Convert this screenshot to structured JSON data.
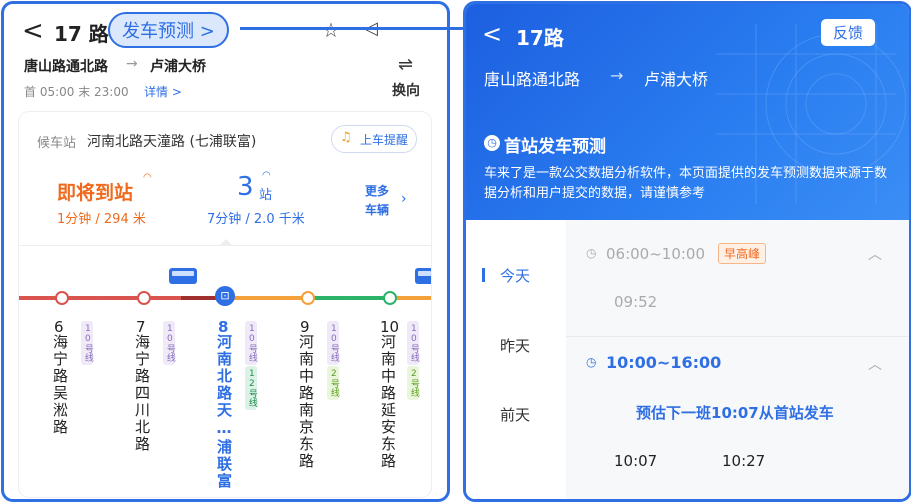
{
  "left": {
    "back_glyph": "<",
    "route": "17 路",
    "predict_pill": "发车预测 >",
    "from": "唐山路通北路",
    "to": "卢浦大桥",
    "arrow": "→",
    "hours": "首 05:00 末 23:00",
    "detail": "详情 >",
    "switch_label": "换向",
    "card": {
      "wait_label": "候车站",
      "wait_station": "河南北路天潼路 (七浦联富)",
      "remind_btn": "上车提醒",
      "bus1_status": "即将到站",
      "bus1_detail": "1分钟 / 294 米",
      "bus2_stops_num": "3",
      "bus2_stops_unit": "站",
      "bus2_detail": "7分钟 / 2.0 千米",
      "more_line1": "更多",
      "more_line2": "车辆"
    },
    "stops": [
      {
        "num": "6",
        "name": "海宁路吴淞路",
        "tags": [
          {
            "text": "10号线",
            "color": "#b5a3d6"
          }
        ]
      },
      {
        "num": "7",
        "name": "海宁路四川北路",
        "tags": [
          {
            "text": "10号线",
            "color": "#b5a3d6"
          }
        ]
      },
      {
        "num": "8",
        "name": "河南北路天…浦联富",
        "tags": [
          {
            "text": "10号线",
            "color": "#b5a3d6"
          },
          {
            "text": "12号线",
            "color": "#3aa86b"
          }
        ]
      },
      {
        "num": "9",
        "name": "河南中路南京东路",
        "tags": [
          {
            "text": "10号线",
            "color": "#b5a3d6"
          },
          {
            "text": "2号线",
            "color": "#7ac143"
          }
        ]
      },
      {
        "num": "10",
        "name": "河南中路延安东路",
        "tags": [
          {
            "text": "10号线",
            "color": "#b5a3d6"
          },
          {
            "text": "2号线",
            "color": "#7ac143"
          }
        ]
      }
    ]
  },
  "right": {
    "back_glyph": "<",
    "route": "17路",
    "feedback": "反馈",
    "from": "唐山路通北路",
    "to": "卢浦大桥",
    "arrow": "→",
    "section_title": "首站发车预测",
    "disclaimer": "车来了是一款公交数据分析软件，本页面提供的发车预测数据来源于数据分析和用户提交的数据，请谨慎参考",
    "days": [
      "今天",
      "昨天",
      "前天"
    ],
    "slot1_range": "06:00~10:00",
    "slot1_badge": "早高峰",
    "slot1_time": "09:52",
    "slot2_range": "10:00~16:00",
    "slot2_predict": "预估下一班10:07从首站发车",
    "slot2_times": [
      "10:07",
      "10:27"
    ]
  },
  "colors": {
    "accent": "#2f6fe4",
    "orange": "#f06a1d",
    "route_red": "#d9534f",
    "route_orange": "#f5a13b",
    "route_green": "#2bb36a"
  }
}
